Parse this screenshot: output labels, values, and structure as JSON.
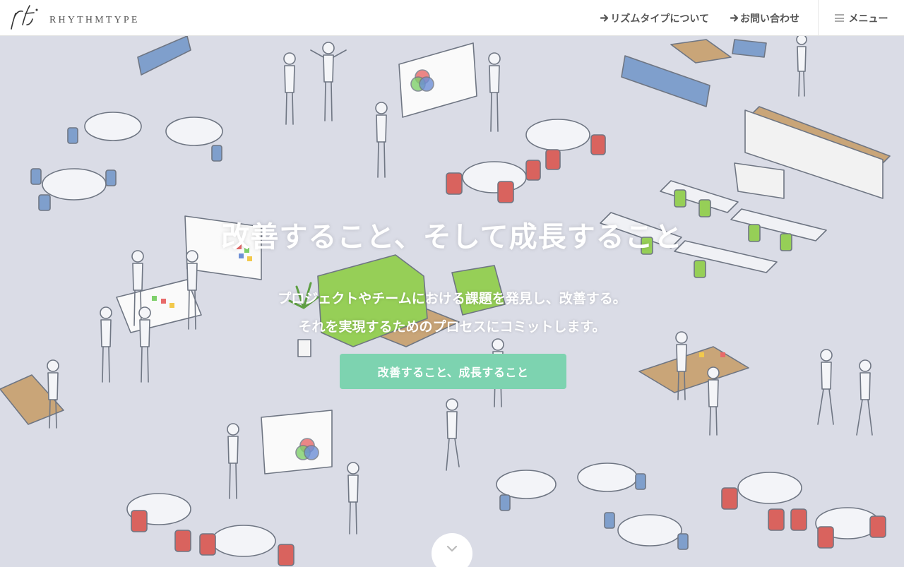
{
  "header": {
    "logo_text": "RHYTHMTYPE",
    "nav": [
      {
        "label": "リズムタイプについて",
        "icon": "arrow-right-icon"
      },
      {
        "label": "お問い合わせ",
        "icon": "arrow-right-icon"
      }
    ],
    "menu_label": "メニュー",
    "menu_icon": "hamburger-icon"
  },
  "hero": {
    "title": "改善すること、そして成長すること",
    "subtitle_line1": "プロジェクトやチームにおける課題を発見し、改善する。",
    "subtitle_line2": "それを実現するためのプロセスにコミットします。",
    "cta_label": "改善すること、成長すること",
    "scroll_icon": "chevron-down-icon"
  },
  "colors": {
    "background": "#dadce6",
    "cta": "#7dd3b0",
    "chair_red": "#d9635e",
    "sofa_blue": "#7f9fcc",
    "sofa_green": "#96cf57",
    "table_wood": "#c9a578"
  }
}
